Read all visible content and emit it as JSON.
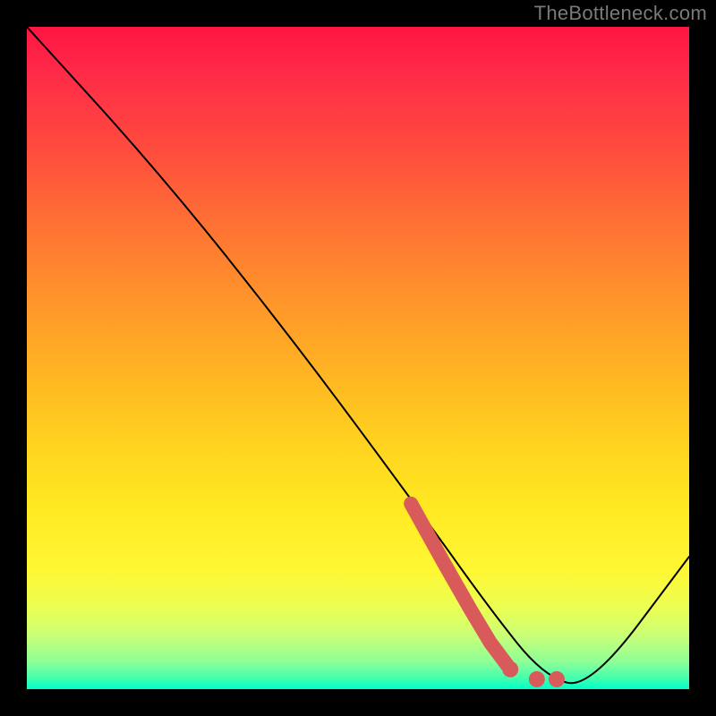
{
  "watermark": "TheBottleneck.com",
  "chart_data": {
    "type": "line",
    "title": "",
    "xlabel": "",
    "ylabel": "",
    "xlim": [
      0,
      100
    ],
    "ylim": [
      0,
      100
    ],
    "grid": false,
    "legend": false,
    "series": [
      {
        "name": "bottleneck-curve",
        "color": "#000000",
        "x": [
          0,
          20,
          40,
          60,
          70,
          78,
          85,
          100
        ],
        "y": [
          100,
          78,
          53,
          26,
          12,
          2,
          0,
          20
        ]
      },
      {
        "name": "highlight-segment",
        "color": "#d85a5a",
        "x": [
          58,
          63,
          67,
          70,
          73,
          77,
          80
        ],
        "y": [
          28,
          19,
          12,
          7,
          3,
          1.5,
          1.5
        ]
      }
    ],
    "annotations": []
  },
  "colors": {
    "background": "#000000",
    "line": "#000000",
    "highlight": "#d85a5a",
    "gradient_top": "#ff1442",
    "gradient_mid": "#ffd01f",
    "gradient_bottom": "#00ffcc"
  }
}
